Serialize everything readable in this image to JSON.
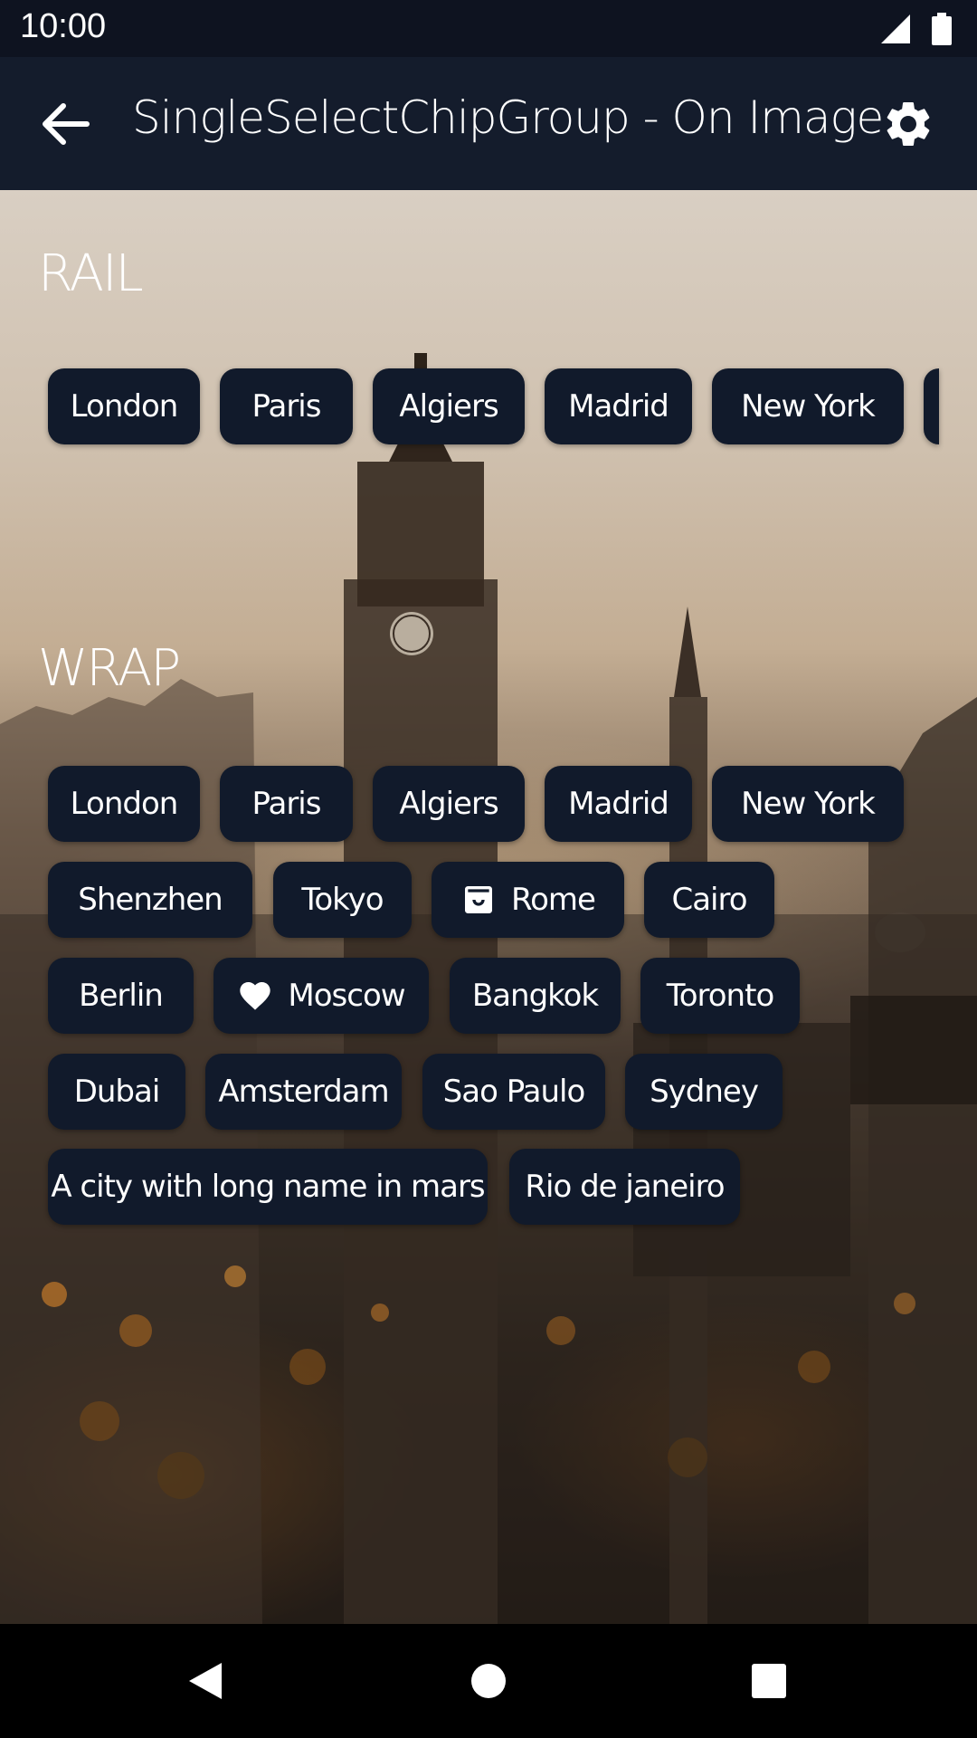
{
  "status_bar": {
    "time": "10:00"
  },
  "app_bar": {
    "title": "SingleSelectChipGroup - On Image"
  },
  "rail": {
    "title": "RAIL",
    "chips": [
      "London",
      "Paris",
      "Algiers",
      "Madrid",
      "New York"
    ]
  },
  "wrap": {
    "title": "WRAP",
    "chips": [
      "London",
      "Paris",
      "Algiers",
      "Madrid",
      "New York",
      "Shenzhen",
      "Tokyo",
      "Rome",
      "Cairo",
      "Berlin",
      "Moscow",
      "Bangkok",
      "Toronto",
      "Dubai",
      "Amsterdam",
      "Sao Paulo",
      "Sydney",
      "A city with long name in mars",
      "Rio de janeiro"
    ]
  },
  "icons": {
    "rome_chip": "shopping-bag-icon",
    "moscow_chip": "heart-icon"
  },
  "colors": {
    "app_bar": "#141c2c",
    "status_bar": "#0e1320",
    "chip": "#111a2b",
    "chip_text": "#ffffff"
  }
}
